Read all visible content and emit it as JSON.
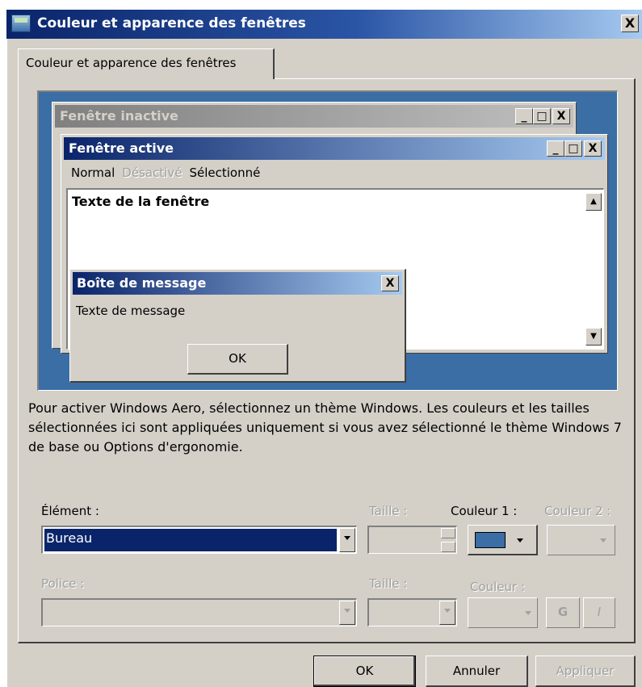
{
  "window": {
    "title": "Couleur et apparence des fenêtres",
    "close_glyph": "X",
    "icon": "display-settings-icon"
  },
  "tab": {
    "label": "Couleur et apparence des fenêtres"
  },
  "preview": {
    "desktop_color": "#3a6ea5",
    "inactive_window": {
      "title": "Fenêtre inactive",
      "buttons": [
        "_",
        "□",
        "X"
      ]
    },
    "active_window": {
      "title": "Fenêtre active",
      "buttons": [
        "_",
        "□",
        "X"
      ],
      "menu": {
        "normal": "Normal",
        "disabled": "Désactivé",
        "selected": "Sélectionné"
      },
      "window_text": "Texte de la fenêtre"
    },
    "message_box": {
      "title": "Boîte de message",
      "close_glyph": "X",
      "text": "Texte de message",
      "ok_label": "OK"
    }
  },
  "description": "Pour activer Windows Aero, sélectionnez un thème Windows. Les couleurs et les tailles sélectionnées ici sont appliquées uniquement si vous avez sélectionné le thème Windows 7 de base ou Options d'ergonomie.",
  "item": {
    "label": "Élément :",
    "value": "Bureau",
    "size_label": "Taille :",
    "color1_label": "Couleur 1 :",
    "color1_value": "#3a6ea5",
    "color2_label": "Couleur 2 :"
  },
  "font": {
    "label": "Police :",
    "size_label": "Taille :",
    "color_label": "Couleur :",
    "bold_label": "G",
    "italic_label": "I"
  },
  "footer": {
    "ok_label": "OK",
    "cancel_label": "Annuler",
    "apply_label": "Appliquer"
  }
}
